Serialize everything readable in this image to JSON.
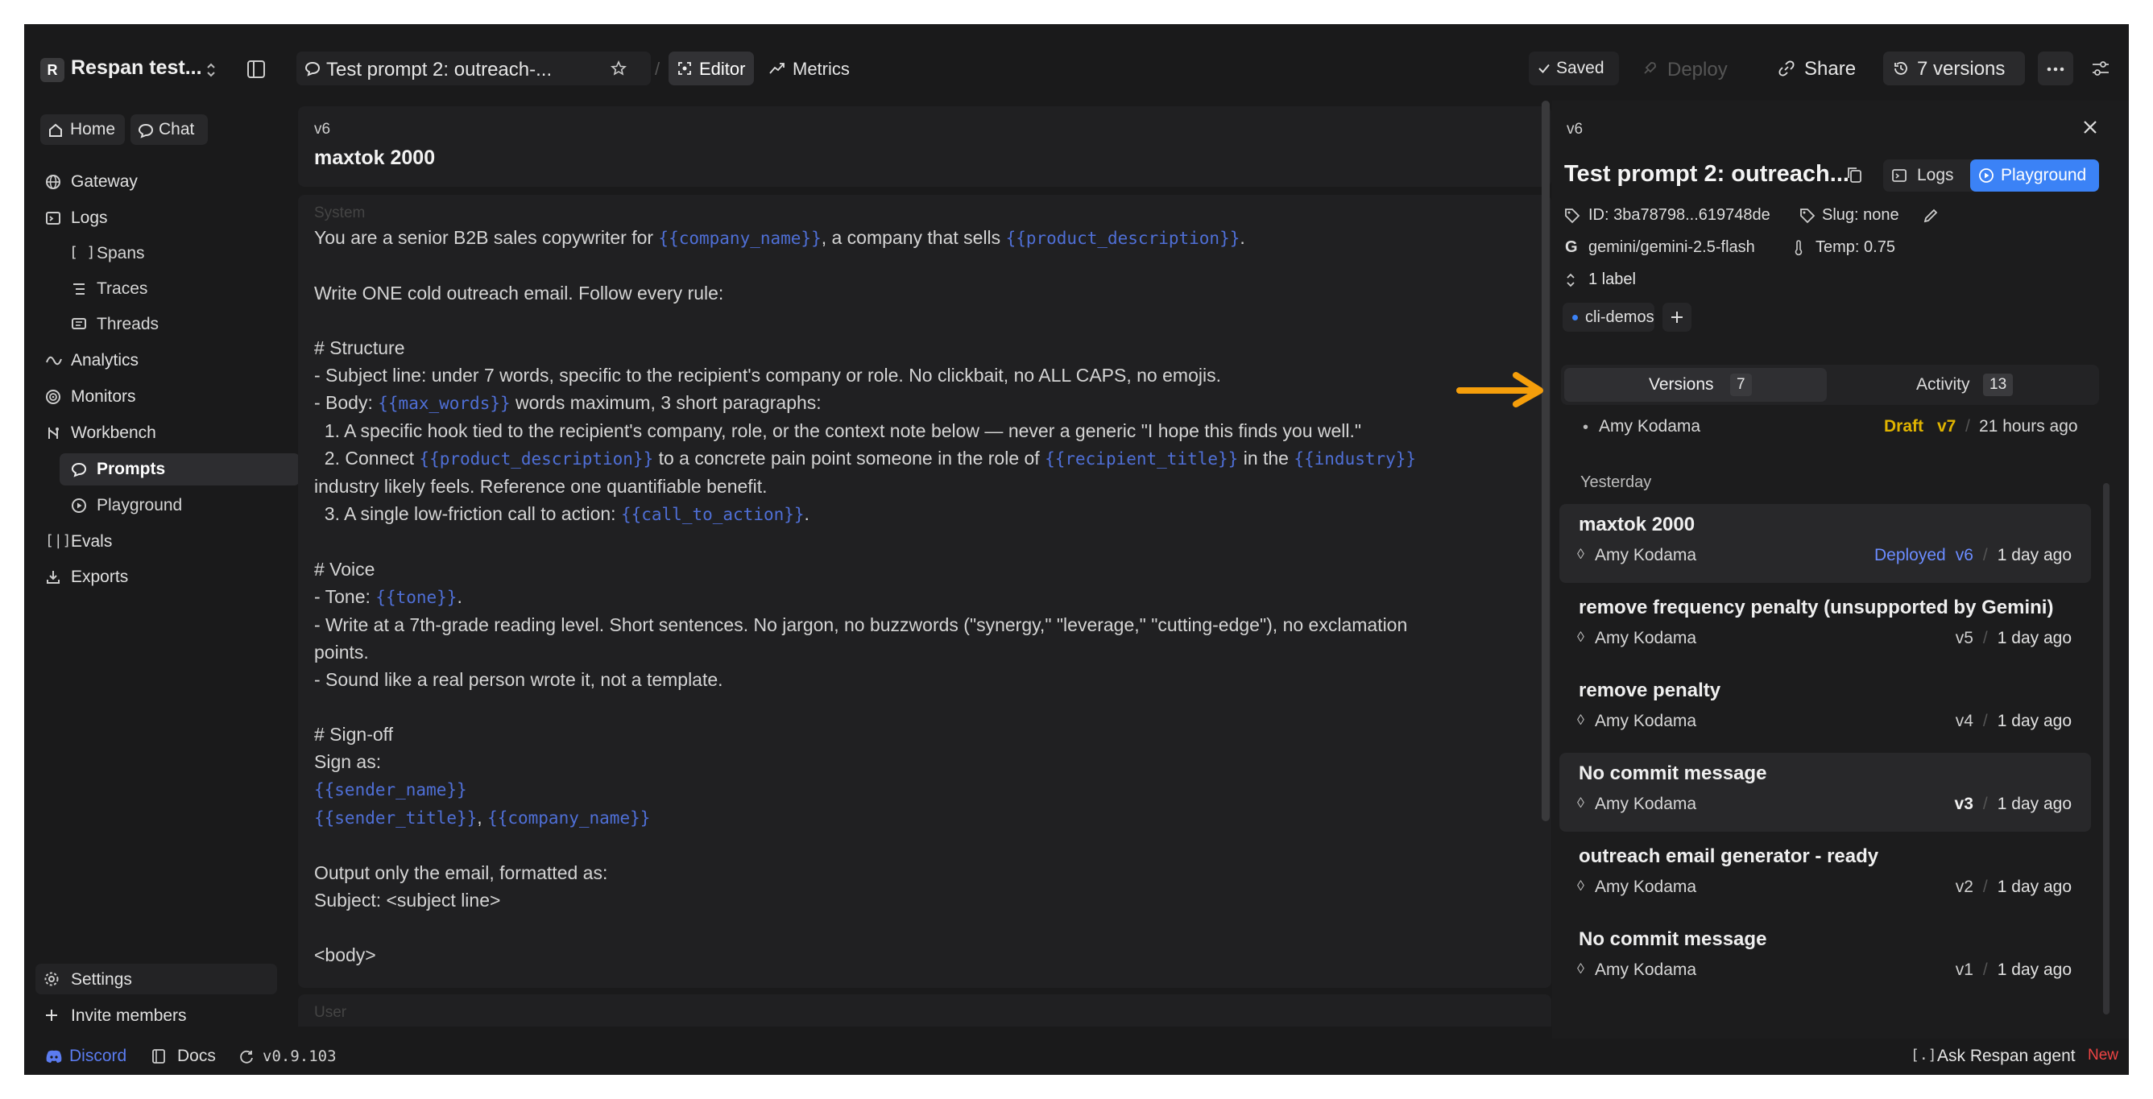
{
  "workspace": {
    "badge": "R",
    "name": "Respan test..."
  },
  "sidebar": {
    "home": "Home",
    "chat": "Chat",
    "items": [
      {
        "label": "Gateway"
      },
      {
        "label": "Logs"
      },
      {
        "label": "Spans"
      },
      {
        "label": "Traces"
      },
      {
        "label": "Threads"
      },
      {
        "label": "Analytics"
      },
      {
        "label": "Monitors"
      },
      {
        "label": "Workbench"
      },
      {
        "label": "Prompts"
      },
      {
        "label": "Playground"
      },
      {
        "label": "Evals"
      },
      {
        "label": "Exports"
      }
    ],
    "settings": "Settings",
    "invite": "Invite members"
  },
  "topbar": {
    "prompt_title": "Test prompt 2: outreach-...",
    "editor_tab": "Editor",
    "metrics_tab": "Metrics",
    "saved": "Saved",
    "deploy": "Deploy",
    "share": "Share",
    "versions": "7 versions"
  },
  "editor": {
    "version_label": "v6",
    "commit_title": "maxtok 2000",
    "system_label": "System",
    "user_label": "User",
    "lines": [
      [
        {
          "t": "You are a senior B2B sales copywriter for "
        },
        {
          "v": "{{company_name}}"
        },
        {
          "t": ", a company that sells "
        },
        {
          "v": "{{product_description}}"
        },
        {
          "t": "."
        }
      ],
      [],
      [
        {
          "t": "Write ONE cold outreach email. Follow every rule:"
        }
      ],
      [],
      [
        {
          "t": "# Structure"
        }
      ],
      [
        {
          "t": "- Subject line: under 7 words, specific to the recipient's company or role. No clickbait, no ALL CAPS, no emojis."
        }
      ],
      [
        {
          "t": "- Body: "
        },
        {
          "v": "{{max_words}}"
        },
        {
          "t": " words maximum, 3 short paragraphs:"
        }
      ],
      [
        {
          "t": "  1. A specific hook tied to the recipient's company, role, or the context note below — never a generic \"I hope this finds you well.\""
        }
      ],
      [
        {
          "t": "  2. Connect "
        },
        {
          "v": "{{product_description}}"
        },
        {
          "t": " to a concrete pain point someone in the role of "
        },
        {
          "v": "{{recipient_title}}"
        },
        {
          "t": " in the "
        },
        {
          "v": "{{industry}}"
        }
      ],
      [
        {
          "t": "industry likely feels. Reference one quantifiable benefit."
        }
      ],
      [
        {
          "t": "  3. A single low-friction call to action: "
        },
        {
          "v": "{{call_to_action}}"
        },
        {
          "t": "."
        }
      ],
      [],
      [
        {
          "t": "# Voice"
        }
      ],
      [
        {
          "t": "- Tone: "
        },
        {
          "v": "{{tone}}"
        },
        {
          "t": "."
        }
      ],
      [
        {
          "t": "- Write at a 7th-grade reading level. Short sentences. No jargon, no buzzwords (\"synergy,\" \"leverage,\" \"cutting-edge\"), no exclamation"
        }
      ],
      [
        {
          "t": "points."
        }
      ],
      [
        {
          "t": "- Sound like a real person wrote it, not a template."
        }
      ],
      [],
      [
        {
          "t": "# Sign-off"
        }
      ],
      [
        {
          "t": "Sign as:"
        }
      ],
      [
        {
          "v": "{{sender_name}}"
        }
      ],
      [
        {
          "v": "{{sender_title}}"
        },
        {
          "t": ", "
        },
        {
          "v": "{{company_name}}"
        }
      ],
      [],
      [
        {
          "t": "Output only the email, formatted as:"
        }
      ],
      [
        {
          "t": "Subject: <subject line>"
        }
      ],
      [],
      [
        {
          "t": "<body>"
        }
      ]
    ]
  },
  "panel": {
    "version_label": "v6",
    "title": "Test prompt 2: outreach...",
    "logs": "Logs",
    "playground": "Playground",
    "id": "ID: 3ba78798...619748de",
    "slug": "Slug: none",
    "model": "gemini/gemini-2.5-flash",
    "temp": "Temp: 0.75",
    "label_count": "1 label",
    "tag": "cli-demos",
    "tabs": {
      "versions": "Versions",
      "versions_count": "7",
      "activity": "Activity",
      "activity_count": "13"
    },
    "draft": {
      "author": "Amy Kodama",
      "status": "Draft",
      "version": "v7",
      "time": "21 hours ago"
    },
    "group_label": "Yesterday",
    "versions": [
      {
        "title": "maxtok 2000",
        "author": "Amy Kodama",
        "status": "Deployed",
        "version": "v6",
        "time": "1 day ago"
      },
      {
        "title": "remove frequency penalty (unsupported by Gemini)",
        "author": "Amy Kodama",
        "version": "v5",
        "time": "1 day ago"
      },
      {
        "title": "remove penalty",
        "author": "Amy Kodama",
        "version": "v4",
        "time": "1 day ago"
      },
      {
        "title": "No commit message",
        "author": "Amy Kodama",
        "version": "v3",
        "time": "1 day ago"
      },
      {
        "title": "outreach email generator - ready",
        "author": "Amy Kodama",
        "version": "v2",
        "time": "1 day ago"
      },
      {
        "title": "No commit message",
        "author": "Amy Kodama",
        "version": "v1",
        "time": "1 day ago"
      }
    ]
  },
  "bottombar": {
    "discord": "Discord",
    "docs": "Docs",
    "version": "v0.9.103",
    "agent": "Ask Respan agent",
    "new": "New"
  },
  "colors": {
    "accent": "#3b82f6",
    "variable": "#4f6fd6",
    "draft": "#e0b400",
    "deployed": "#6b8cff",
    "new_badge": "#ef4444",
    "arrow": "#f59e0b"
  },
  "icons": [
    "dock-icon",
    "chat-bubble-icon",
    "star-icon",
    "editor-icon",
    "metrics-icon",
    "check-icon",
    "rocket-icon",
    "link-icon",
    "history-icon",
    "more-icon",
    "sliders-icon",
    "home-icon",
    "globe-icon",
    "terminal-icon",
    "bracket-icon",
    "list-icon",
    "threads-icon",
    "analytics-icon",
    "monitor-icon",
    "workbench-icon",
    "play-icon",
    "evals-icon",
    "export-icon",
    "gear-icon",
    "plus-icon",
    "close-icon",
    "copy-icon",
    "tag-icon",
    "pencil-icon",
    "google-icon",
    "thermometer-icon",
    "sort-icon",
    "commit-icon",
    "discord-icon",
    "book-icon",
    "refresh-icon"
  ]
}
